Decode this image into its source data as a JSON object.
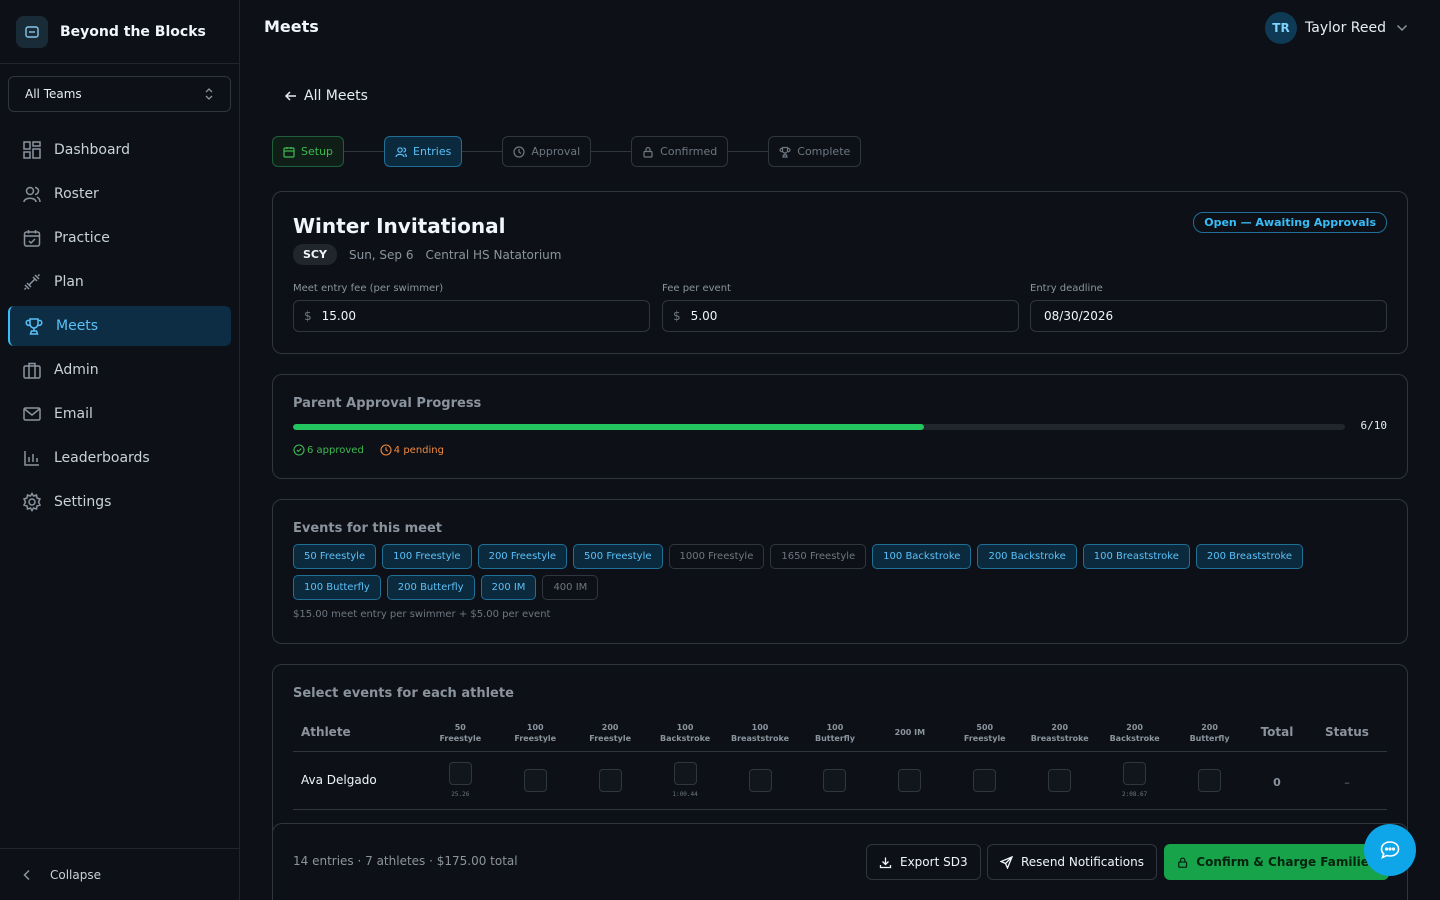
{
  "brand": {
    "name": "Beyond the Blocks"
  },
  "team_select": {
    "value": "All Teams"
  },
  "nav": {
    "items": [
      {
        "label": "Dashboard"
      },
      {
        "label": "Roster"
      },
      {
        "label": "Practice"
      },
      {
        "label": "Plan"
      },
      {
        "label": "Meets"
      },
      {
        "label": "Admin"
      },
      {
        "label": "Email"
      },
      {
        "label": "Leaderboards"
      },
      {
        "label": "Settings"
      }
    ],
    "active": "Meets"
  },
  "sidebar": {
    "collapse_label": "Collapse"
  },
  "header": {
    "title": "Meets",
    "user": {
      "initials": "TR",
      "name": "Taylor Reed"
    }
  },
  "back_link": "All Meets",
  "steps": [
    {
      "label": "Setup",
      "state": "done"
    },
    {
      "label": "Entries",
      "state": "current"
    },
    {
      "label": "Approval",
      "state": "pending"
    },
    {
      "label": "Confirmed",
      "state": "pending"
    },
    {
      "label": "Complete",
      "state": "pending"
    }
  ],
  "meet": {
    "title": "Winter Invitational",
    "course": "SCY",
    "date": "Sun, Sep 6",
    "venue": "Central HS Natatorium",
    "status": "Open — Awaiting Approvals",
    "fields": [
      {
        "label": "Meet entry fee (per swimmer)",
        "prefix": "$",
        "value": "15.00"
      },
      {
        "label": "Fee per event",
        "prefix": "$",
        "value": "5.00"
      },
      {
        "label": "Entry deadline",
        "prefix": "",
        "value": "08/30/2026"
      }
    ]
  },
  "approval": {
    "title": "Parent Approval Progress",
    "approved": 6,
    "total": 10,
    "count_text": "6/10",
    "approved_text": "6 approved",
    "pending_text": "4 pending"
  },
  "events": {
    "title": "Events for this meet",
    "chips": [
      {
        "label": "50 Freestyle",
        "selected": true
      },
      {
        "label": "100 Freestyle",
        "selected": true
      },
      {
        "label": "200 Freestyle",
        "selected": true
      },
      {
        "label": "500 Freestyle",
        "selected": true
      },
      {
        "label": "1000 Freestyle",
        "selected": false
      },
      {
        "label": "1650 Freestyle",
        "selected": false
      },
      {
        "label": "100 Backstroke",
        "selected": true
      },
      {
        "label": "200 Backstroke",
        "selected": true
      },
      {
        "label": "100 Breaststroke",
        "selected": true
      },
      {
        "label": "200 Breaststroke",
        "selected": true
      },
      {
        "label": "100 Butterfly",
        "selected": true
      },
      {
        "label": "200 Butterfly",
        "selected": true
      },
      {
        "label": "200 IM",
        "selected": true
      },
      {
        "label": "400 IM",
        "selected": false
      }
    ],
    "fee_note": "$15.00 meet entry per swimmer + $5.00 per event"
  },
  "athletes": {
    "title": "Select events for each athlete",
    "athlete_header": "Athlete",
    "total_header": "Total",
    "status_header": "Status",
    "columns": [
      [
        "50",
        "Freestyle"
      ],
      [
        "100",
        "Freestyle"
      ],
      [
        "200",
        "Freestyle"
      ],
      [
        "100",
        "Backstroke"
      ],
      [
        "100",
        "Breaststroke"
      ],
      [
        "100",
        "Butterfly"
      ],
      [
        "200 IM",
        ""
      ],
      [
        "500",
        "Freestyle"
      ],
      [
        "200",
        "Breaststroke"
      ],
      [
        "200",
        "Backstroke"
      ],
      [
        "200",
        "Butterfly"
      ]
    ],
    "rows": [
      {
        "name": "Ava Delgado",
        "times": [
          "25.26",
          "",
          "",
          "1:00.44",
          "",
          "",
          "",
          "",
          "",
          "2:08.67",
          ""
        ],
        "total": "0",
        "status": "–"
      }
    ]
  },
  "footer": {
    "summary": "14 entries · 7 athletes · $175.00 total",
    "export_label": "Export SD3",
    "resend_label": "Resend Notifications",
    "confirm_label": "Confirm & Charge Families"
  },
  "colors": {
    "accent": "#38bdf8",
    "success": "#22c55e",
    "warning": "#f0883e",
    "bg": "#0d1117"
  }
}
